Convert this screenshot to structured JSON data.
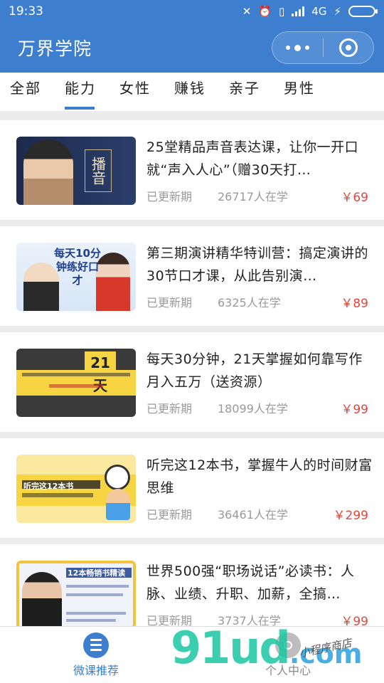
{
  "status_bar": {
    "time": "19:33",
    "network": "4G"
  },
  "header": {
    "title": "万界学院"
  },
  "tabs": [
    {
      "label": "全部",
      "active": false
    },
    {
      "label": "能力",
      "active": true
    },
    {
      "label": "女性",
      "active": false
    },
    {
      "label": "赚钱",
      "active": false
    },
    {
      "label": "亲子",
      "active": false
    },
    {
      "label": "男性",
      "active": false
    }
  ],
  "courses": [
    {
      "title": "25堂精品声音表达课，让你一开口就“声入人心”（赠30天打…",
      "update": "已更新期",
      "learners": "26717人在学",
      "price": "￥69",
      "thumb_text": "播音"
    },
    {
      "title": "第三期演讲精华特训营：搞定演讲的30节口才课，从此告别演…",
      "update": "已更新期",
      "learners": "6325人在学",
      "price": "￥89",
      "thumb_text": "每天10分钟练好口才"
    },
    {
      "title": "每天30分钟，21天掌握如何靠写作月入五万（送资源）",
      "update": "已更新期",
      "learners": "18099人在学",
      "price": "￥99",
      "thumb_text": "21天"
    },
    {
      "title": "听完这12本书，掌握牛人的时间财富思维",
      "update": "已更新期",
      "learners": "36461人在学",
      "price": "￥299",
      "thumb_text": "听完这12本书"
    },
    {
      "title": "世界500强“职场说话”必读书：人脉、业绩、升职、加薪，全搞…",
      "update": "已更新期",
      "learners": "3737人在学",
      "price": "￥99",
      "thumb_text": "12本畅销书精读"
    }
  ],
  "bottom_nav": [
    {
      "label": "微课推荐",
      "active": true
    },
    {
      "label": "个人中心",
      "active": false
    }
  ],
  "watermark": {
    "text": "91ud",
    "suffix": ".com",
    "tagline": "小程序商店"
  },
  "colors": {
    "brand": "#3d7fce",
    "price": "#e5443a"
  }
}
